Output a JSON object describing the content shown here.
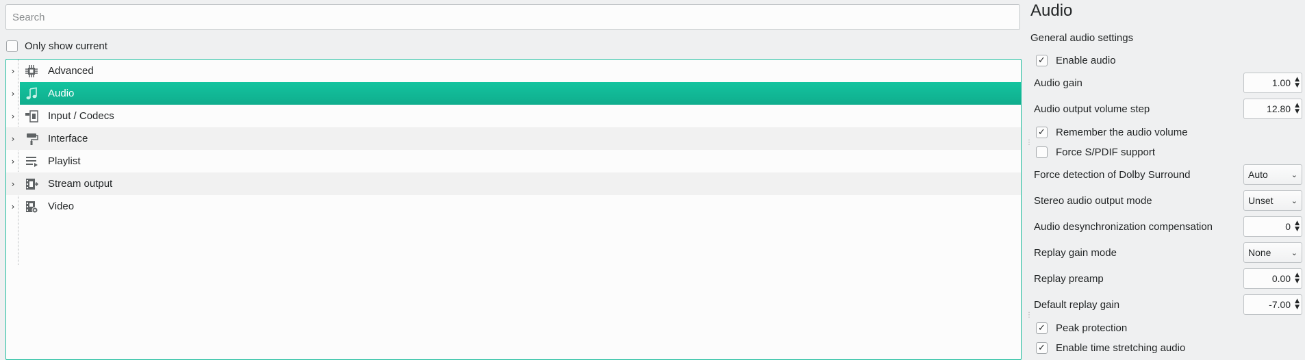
{
  "search": {
    "placeholder": "Search"
  },
  "only_show_current": {
    "label": "Only show current",
    "checked": false
  },
  "tree": {
    "items": [
      {
        "label": "Advanced",
        "icon": "chip-icon"
      },
      {
        "label": "Audio",
        "icon": "music-note-icon",
        "selected": true
      },
      {
        "label": "Input / Codecs",
        "icon": "input-codecs-icon"
      },
      {
        "label": "Interface",
        "icon": "paint-roller-icon"
      },
      {
        "label": "Playlist",
        "icon": "playlist-icon"
      },
      {
        "label": "Stream output",
        "icon": "stream-output-icon"
      },
      {
        "label": "Video",
        "icon": "film-gear-icon"
      }
    ]
  },
  "panel": {
    "title": "Audio",
    "subtitle": "General audio settings",
    "enable_audio": {
      "label": "Enable audio",
      "checked": true
    },
    "audio_gain": {
      "label": "Audio gain",
      "value": "1.00"
    },
    "volume_step": {
      "label": "Audio output volume step",
      "value": "12.80"
    },
    "remember_volume": {
      "label": "Remember the audio volume",
      "checked": true
    },
    "force_spdif": {
      "label": "Force S/PDIF support",
      "checked": false
    },
    "dolby": {
      "label": "Force detection of Dolby Surround",
      "value": "Auto"
    },
    "stereo_mode": {
      "label": "Stereo audio output mode",
      "value": "Unset"
    },
    "desync": {
      "label": "Audio desynchronization compensation",
      "value": "0"
    },
    "replay_gain_mode": {
      "label": "Replay gain mode",
      "value": "None"
    },
    "replay_preamp": {
      "label": "Replay preamp",
      "value": "0.00"
    },
    "default_replay_gain": {
      "label": "Default replay gain",
      "value": "-7.00"
    },
    "peak_protection": {
      "label": "Peak protection",
      "checked": true
    },
    "time_stretching": {
      "label": "Enable time stretching audio",
      "checked": true
    }
  },
  "colors": {
    "accent": "#1abc9c",
    "selected_row": "#13b596"
  }
}
